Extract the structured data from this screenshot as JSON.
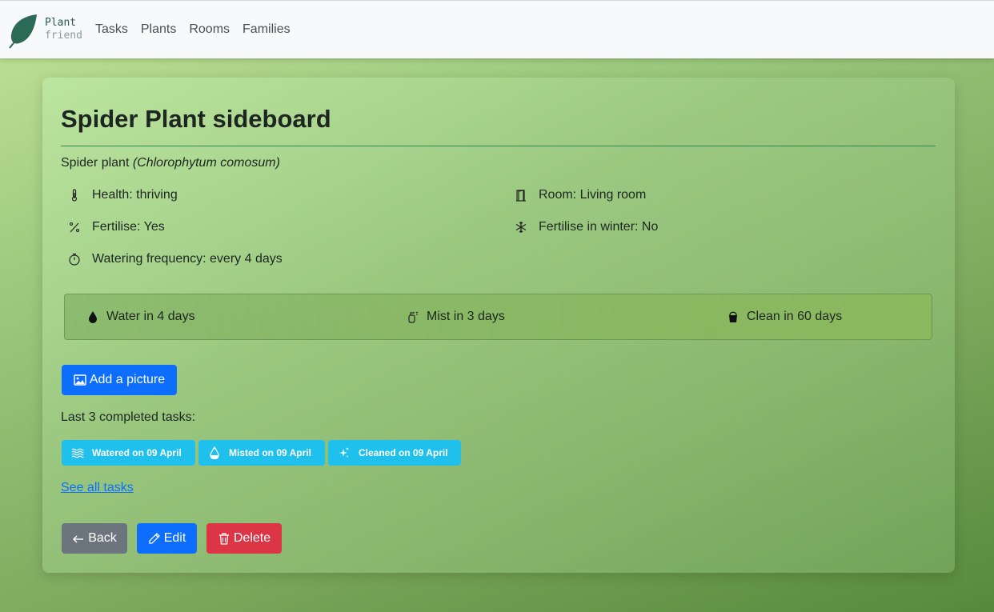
{
  "brand": {
    "line1": "Plant",
    "line2": "friend",
    "icon": "leaf-icon"
  },
  "nav": [
    "Tasks",
    "Plants",
    "Rooms",
    "Families"
  ],
  "plant": {
    "title": "Spider Plant sideboard",
    "common_name": "Spider plant",
    "scientific_name": "(Chlorophytum comosum)"
  },
  "attributes": {
    "health": "Health: thriving",
    "room": "Room: Living room",
    "fertilise": "Fertilise: Yes",
    "fertilise_winter": "Fertilise in winter: No",
    "watering": "Watering frequency: every 4 days"
  },
  "due": {
    "water": "Water in 4 days",
    "mist": "Mist in 3 days",
    "clean": "Clean in 60 days"
  },
  "buttons": {
    "add_picture": "Add a picture",
    "back": "Back",
    "edit": "Edit",
    "delete": "Delete"
  },
  "tasks": {
    "heading": "Last 3 completed tasks:",
    "items": [
      "Watered on 09 April",
      "Misted on 09 April",
      "Cleaned on 09 April"
    ],
    "see_all": "See all tasks"
  },
  "colors": {
    "primary": "#0d6efd",
    "secondary": "#6c757d",
    "danger": "#dc3545",
    "info_badge": "#1fc1ec",
    "brand_green": "#2b5b4f"
  }
}
